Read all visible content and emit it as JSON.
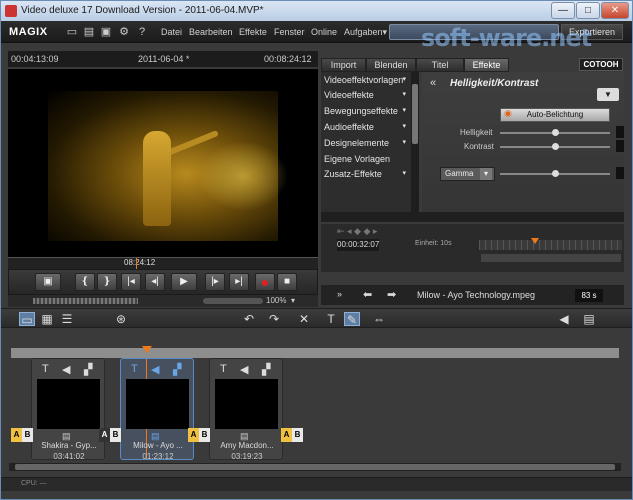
{
  "window": {
    "title": "Video deluxe 17 Download Version - 2011-06-04.MVP*",
    "min": "—",
    "max": "□",
    "close": "✕"
  },
  "menubar": {
    "logo": "MAGIX",
    "items": [
      "Datei",
      "Bearbeiten",
      "Effekte",
      "Fenster",
      "Online",
      "Aufgaben▾"
    ],
    "export_label": "Exportieren",
    "watermark": "soft-ware.net"
  },
  "monitor": {
    "timecode_left": "00:04:13:09",
    "title": "2011-06-04 *",
    "timecode_right": "00:08:24:12",
    "position_timecode": "08:24:12",
    "zoom": "100%",
    "zoom_arrow": "▾"
  },
  "transport": {
    "buttons": [
      "❴",
      "❵",
      "|◂",
      "◂|",
      "▶",
      "|▸",
      "▸|"
    ]
  },
  "panel": {
    "tabs": [
      "Import",
      "Blenden",
      "Titel",
      "Effekte"
    ],
    "cotooh": "COTOOH",
    "fx_items": [
      {
        "label": "Videoeffektvorlagen",
        "arrow": "▾"
      },
      {
        "label": "Videoeffekte",
        "arrow": "▾"
      },
      {
        "label": "Bewegungseffekte",
        "arrow": "▾"
      },
      {
        "label": "Audioeffekte",
        "arrow": "▾"
      },
      {
        "label": "Designelemente",
        "arrow": "▾"
      },
      {
        "label": "Eigene Vorlagen",
        "arrow": ""
      },
      {
        "label": "Zusatz-Effekte",
        "arrow": "▾"
      }
    ],
    "effect_title": "Helligkeit/Kontrast",
    "effect_back": "«",
    "dropdown": "▼",
    "auto_button": "Auto-Belichtung",
    "brightness_label": "Helligkeit",
    "contrast_label": "Kontrast",
    "gamma_label": "Gamma",
    "brightness_value": 0.5,
    "contrast_value": 0.5,
    "gamma_value": 0.5
  },
  "timeline_mini": {
    "time": "00:00:32:07",
    "units": "Einheit: 10s"
  },
  "fileinfo": {
    "filename": "Milow - Ayo Technology.mpeg",
    "fps": "83 s"
  },
  "storyboard": {
    "clips": [
      {
        "name": "Shakira - Gyp...",
        "duration": "03:41:02"
      },
      {
        "name": "Milow - Ayo ...",
        "duration": "01:23:12"
      },
      {
        "name": "Amy Macdon...",
        "duration": "03:19:23"
      }
    ],
    "ab_a": "A",
    "ab_b": "B"
  },
  "status": {
    "cpu": "CPU: —"
  }
}
